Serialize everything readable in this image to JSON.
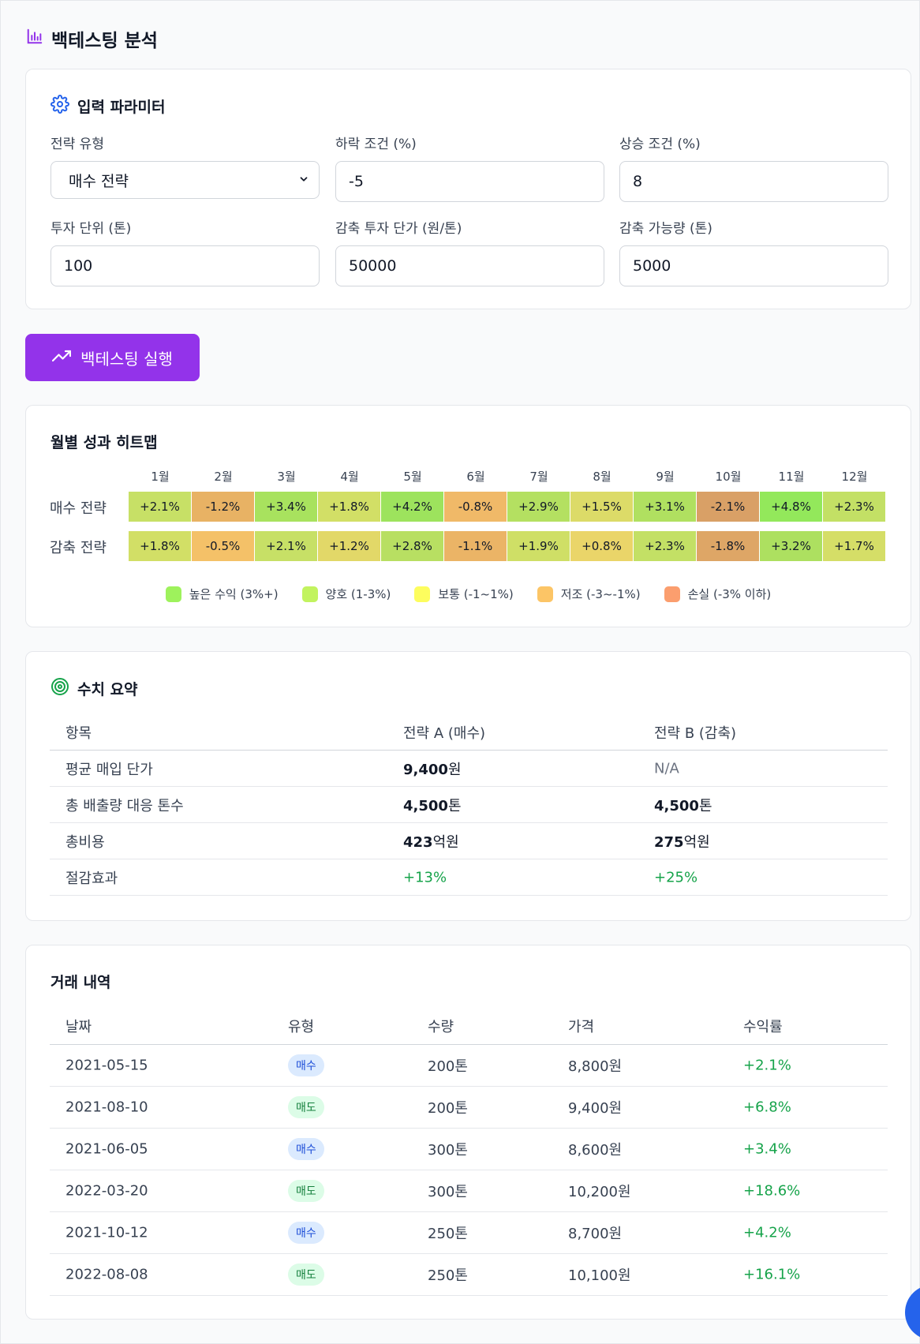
{
  "page": {
    "title": "백테스팅 분석"
  },
  "params": {
    "title": "입력 파라미터",
    "strategy_label": "전략 유형",
    "strategy_value": "매수 전략",
    "drop_label": "하락 조건 (%)",
    "drop_value": "-5",
    "rise_label": "상승 조건 (%)",
    "rise_value": "8",
    "unit_label": "투자 단위 (톤)",
    "unit_value": "100",
    "price_label": "감축 투자 단가 (원/톤)",
    "price_value": "50000",
    "capacity_label": "감축 가능량 (톤)",
    "capacity_value": "5000"
  },
  "run_button": {
    "label": "백테스팅 실행"
  },
  "heatmap": {
    "title": "월별 성과 히트맵",
    "months": [
      "1월",
      "2월",
      "3월",
      "4월",
      "5월",
      "6월",
      "7월",
      "8월",
      "9월",
      "10월",
      "11월",
      "12월"
    ],
    "rows": [
      {
        "label": "매수 전략",
        "cells": [
          {
            "text": "+2.1%",
            "color": "#c7e066"
          },
          {
            "text": "-1.2%",
            "color": "#e8b264"
          },
          {
            "text": "+3.4%",
            "color": "#a8e25e"
          },
          {
            "text": "+1.8%",
            "color": "#d2df66"
          },
          {
            "text": "+4.2%",
            "color": "#9de35d"
          },
          {
            "text": "-0.8%",
            "color": "#f0b968"
          },
          {
            "text": "+2.9%",
            "color": "#b4e061"
          },
          {
            "text": "+1.5%",
            "color": "#dcdb68"
          },
          {
            "text": "+3.1%",
            "color": "#b0e060"
          },
          {
            "text": "-2.1%",
            "color": "#d9a066"
          },
          {
            "text": "+4.8%",
            "color": "#93e85b"
          },
          {
            "text": "+2.3%",
            "color": "#c3e065"
          }
        ]
      },
      {
        "label": "감축 전략",
        "cells": [
          {
            "text": "+1.8%",
            "color": "#d2df66"
          },
          {
            "text": "-0.5%",
            "color": "#f4c168"
          },
          {
            "text": "+2.1%",
            "color": "#c7e066"
          },
          {
            "text": "+1.2%",
            "color": "#e2d868"
          },
          {
            "text": "+2.8%",
            "color": "#b8df62"
          },
          {
            "text": "-1.1%",
            "color": "#ebb466"
          },
          {
            "text": "+1.9%",
            "color": "#cfdf66"
          },
          {
            "text": "+0.8%",
            "color": "#ead569"
          },
          {
            "text": "+2.3%",
            "color": "#c3e065"
          },
          {
            "text": "-1.8%",
            "color": "#dea666"
          },
          {
            "text": "+3.2%",
            "color": "#ade060"
          },
          {
            "text": "+1.7%",
            "color": "#d5de67"
          }
        ]
      }
    ],
    "legend": [
      {
        "label": "높은 수익 (3%+)",
        "color": "#9ef25c"
      },
      {
        "label": "양호 (1-3%)",
        "color": "#c2f35f"
      },
      {
        "label": "보통 (-1~1%)",
        "color": "#fdfd5e"
      },
      {
        "label": "저조 (-3~-1%)",
        "color": "#fcc566"
      },
      {
        "label": "손실 (-3% 이하)",
        "color": "#fb9e6e"
      }
    ]
  },
  "summary": {
    "title": "수치 요약",
    "headers": [
      "항목",
      "전략 A (매수)",
      "전략 B (감축)"
    ],
    "rows": [
      {
        "item": "평균 매입 단가",
        "a_num": "9,400",
        "a_unit": "원",
        "b_num": "N/A",
        "b_unit": ""
      },
      {
        "item": "총 배출량 대응 톤수",
        "a_num": "4,500",
        "a_unit": "톤",
        "b_num": "4,500",
        "b_unit": "톤"
      },
      {
        "item": "총비용",
        "a_num": "423",
        "a_unit": "억원",
        "b_num": "275",
        "b_unit": "억원"
      },
      {
        "item": "절감효과",
        "a_num": "+13%",
        "a_unit": "",
        "b_num": "+25%",
        "b_unit": ""
      }
    ]
  },
  "trades": {
    "title": "거래 내역",
    "headers": [
      "날짜",
      "유형",
      "수량",
      "가격",
      "수익률"
    ],
    "rows": [
      {
        "date": "2021-05-15",
        "type": "매수",
        "qty": "200톤",
        "price": "8,800원",
        "ret": "+2.1%"
      },
      {
        "date": "2021-08-10",
        "type": "매도",
        "qty": "200톤",
        "price": "9,400원",
        "ret": "+6.8%"
      },
      {
        "date": "2021-06-05",
        "type": "매수",
        "qty": "300톤",
        "price": "8,600원",
        "ret": "+3.4%"
      },
      {
        "date": "2022-03-20",
        "type": "매도",
        "qty": "300톤",
        "price": "10,200원",
        "ret": "+18.6%"
      },
      {
        "date": "2021-10-12",
        "type": "매수",
        "qty": "250톤",
        "price": "8,700원",
        "ret": "+4.2%"
      },
      {
        "date": "2022-08-08",
        "type": "매도",
        "qty": "250톤",
        "price": "10,100원",
        "ret": "+16.1%"
      }
    ]
  }
}
